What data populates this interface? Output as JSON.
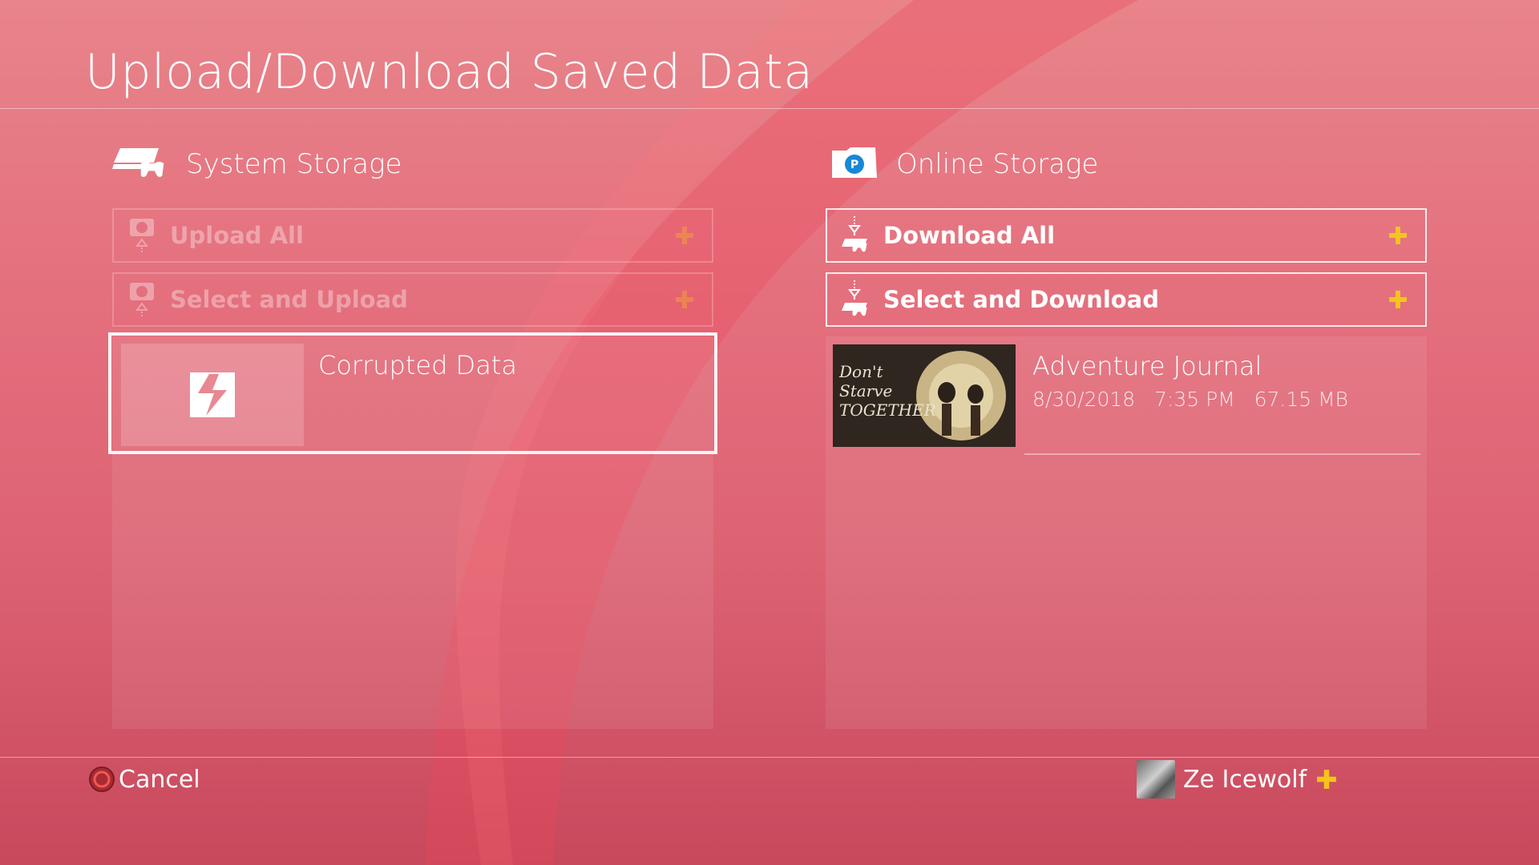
{
  "header": {
    "title": "Upload/Download Saved Data"
  },
  "system_storage": {
    "title": "System Storage",
    "icon": "ps4-console-icon",
    "actions": [
      {
        "label": "Upload All",
        "enabled": false,
        "icon": "upload-icon",
        "plus_icon": "ps-plus-icon"
      },
      {
        "label": "Select and Upload",
        "enabled": false,
        "icon": "upload-icon",
        "plus_icon": "ps-plus-icon"
      }
    ],
    "items": [
      {
        "name": "Corrupted Data",
        "thumbnail_icon": "corrupted-data-icon",
        "selected": true
      }
    ]
  },
  "online_storage": {
    "title": "Online Storage",
    "icon": "cloud-folder-icon",
    "actions": [
      {
        "label": "Download All",
        "enabled": true,
        "icon": "download-icon",
        "plus_icon": "ps-plus-icon"
      },
      {
        "label": "Select and Download",
        "enabled": true,
        "icon": "download-icon",
        "plus_icon": "ps-plus-icon"
      }
    ],
    "items": [
      {
        "name": "Adventure Journal",
        "date": "8/30/2018",
        "time": "7:35 PM",
        "size": "67.15 MB",
        "meta_line": "8/30/2018   7:35 PM   67.15 MB",
        "thumbnail_text": "Don't Starve TOGETHER"
      }
    ]
  },
  "footer": {
    "cancel_label": "Cancel",
    "cancel_icon": "circle-button-icon",
    "user_name": "Ze Icewolf",
    "user_plus_icon": "ps-plus-icon"
  },
  "colors": {
    "plus_gold": "#f4c51a",
    "circle_button": "#d8463f",
    "accent_blue": "#1787d6"
  }
}
